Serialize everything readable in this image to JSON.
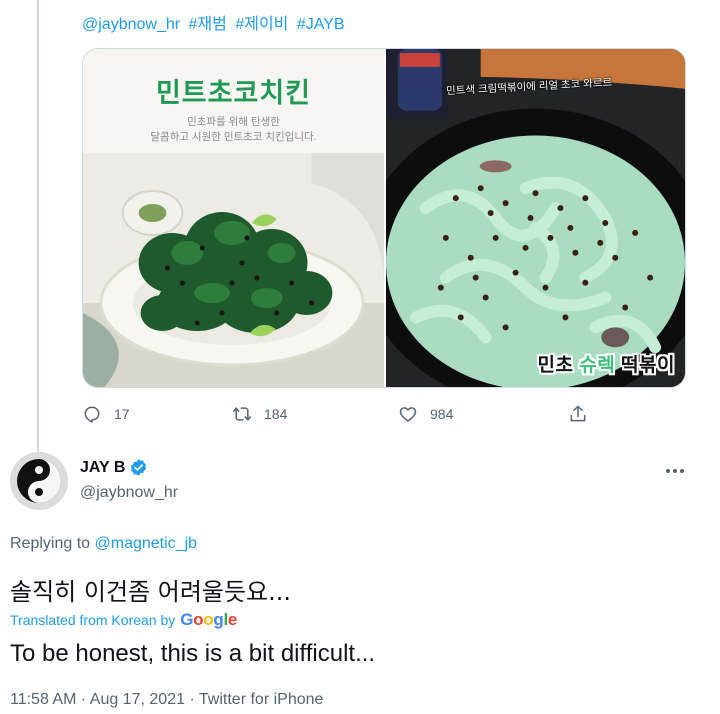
{
  "parent_tweet": {
    "hashtags": [
      "@jaybnow_hr",
      "#재범",
      "#제이비",
      "#JAYB"
    ],
    "media_left": {
      "title": "민트초코치킨",
      "subtitle_line1": "민초파를 위해 탄생한",
      "subtitle_line2": "달콤하고 시원한 민트초코 치킨입니다."
    },
    "media_right": {
      "caption_top": "민트색 크림떡볶이에 리얼 초코 와르르",
      "caption_part1": "민초 ",
      "caption_part2": "슈렉",
      "caption_part3": " 떡볶이"
    },
    "actions": {
      "reply_count": "17",
      "retweet_count": "184",
      "like_count": "984"
    }
  },
  "tweet": {
    "author_name": "JAY B",
    "author_handle": "@jaybnow_hr",
    "replying_prefix": "Replying to ",
    "replying_handle": "@magnetic_jb",
    "text": "솔직히 이건좀 어려울듯요...",
    "translated_label": "Translated from Korean by",
    "google_letters": [
      "G",
      "o",
      "o",
      "g",
      "l",
      "e"
    ],
    "translation": "To be honest, this is a bit difficult...",
    "time": "11:58 AM",
    "separator": " · ",
    "date": "Aug 17, 2021",
    "source": "Twitter for iPhone"
  },
  "colors": {
    "link": "#1d9bf0",
    "secondary_text": "#536471",
    "verified": "#1d9bf0",
    "mint_title": "#1f9a55"
  },
  "icons": [
    "reply-icon",
    "retweet-icon",
    "like-icon",
    "share-icon",
    "verified-badge-icon",
    "more-icon",
    "yin-yang-avatar"
  ]
}
